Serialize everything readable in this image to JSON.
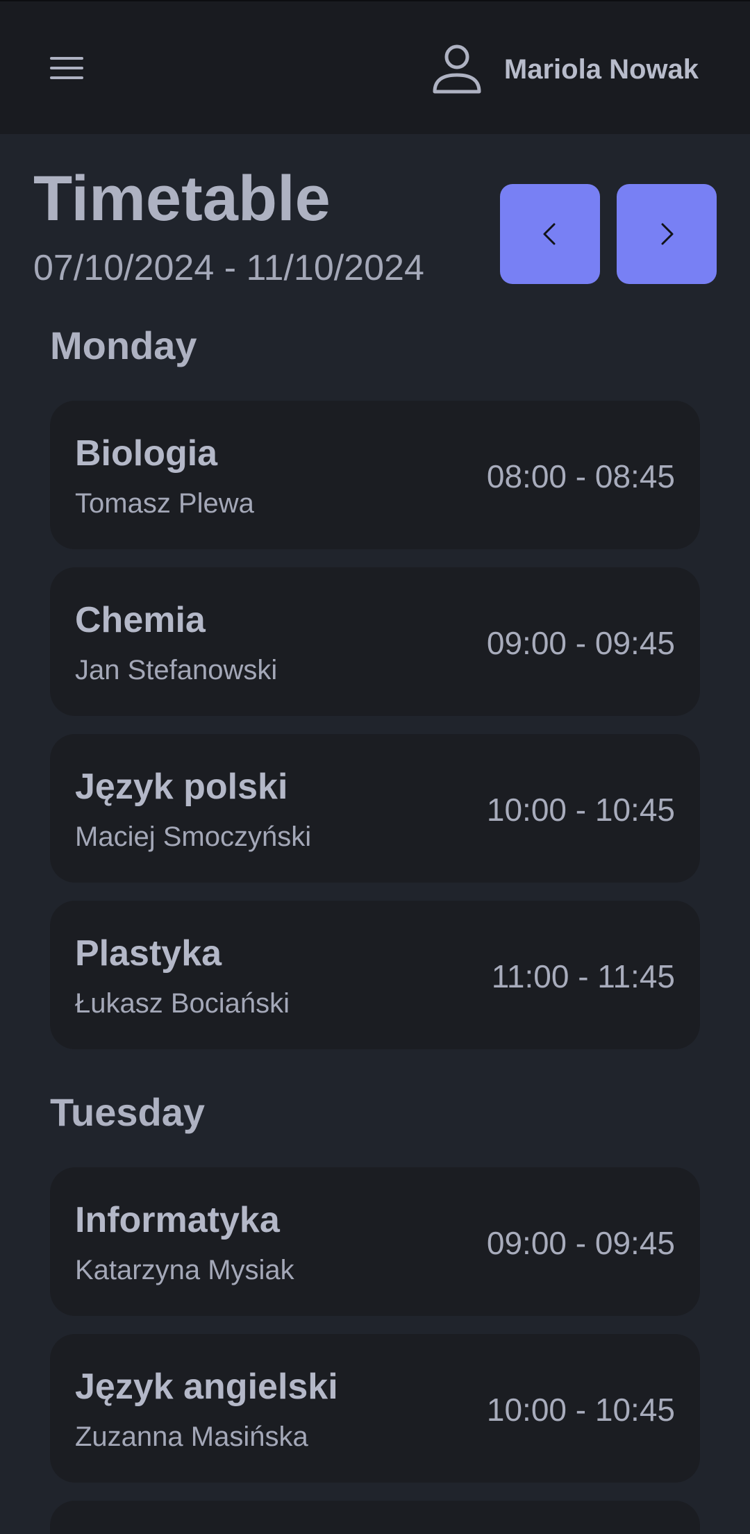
{
  "header": {
    "menu_icon": "hamburger-menu-icon",
    "user_icon": "user-avatar-icon",
    "user_name": "Mariola Nowak"
  },
  "page": {
    "title": "Timetable",
    "date_range": "07/10/2024 - 11/10/2024",
    "prev_icon": "chevron-left-icon",
    "next_icon": "chevron-right-icon"
  },
  "days": [
    {
      "name": "Monday",
      "lessons": [
        {
          "subject": "Biologia",
          "teacher": "Tomasz Plewa",
          "time": "08:00 - 08:45"
        },
        {
          "subject": "Chemia",
          "teacher": "Jan Stefanowski",
          "time": "09:00 - 09:45"
        },
        {
          "subject": "Język polski",
          "teacher": "Maciej Smoczyński",
          "time": "10:00 - 10:45"
        },
        {
          "subject": "Plastyka",
          "teacher": "Łukasz Bociański",
          "time": "11:00 - 11:45"
        }
      ]
    },
    {
      "name": "Tuesday",
      "lessons": [
        {
          "subject": "Informatyka",
          "teacher": "Katarzyna Mysiak",
          "time": "09:00 - 09:45"
        },
        {
          "subject": "Język angielski",
          "teacher": "Zuzanna Masińska",
          "time": "10:00 - 10:45"
        }
      ]
    }
  ],
  "colors": {
    "background": "#20242c",
    "topbar": "#191b20",
    "card": "#1b1d22",
    "accent": "#7880f4",
    "text": "#aeb2c2"
  }
}
